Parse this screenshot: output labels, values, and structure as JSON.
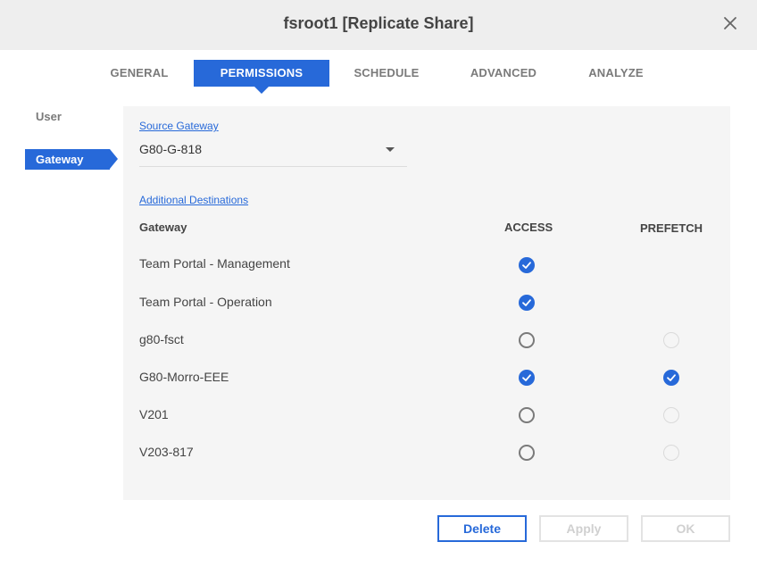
{
  "dialog": {
    "title": "fsroot1 [Replicate Share]"
  },
  "tabs": [
    {
      "label": "GENERAL",
      "active": false
    },
    {
      "label": "PERMISSIONS",
      "active": true
    },
    {
      "label": "SCHEDULE",
      "active": false
    },
    {
      "label": "ADVANCED",
      "active": false
    },
    {
      "label": "ANALYZE",
      "active": false
    }
  ],
  "sidebar": {
    "items": [
      {
        "label": "User",
        "active": false
      },
      {
        "label": "Gateway",
        "active": true
      }
    ]
  },
  "source_gateway": {
    "label": "Source Gateway",
    "value": "G80-G-818"
  },
  "additional_destinations": {
    "label": "Additional Destinations",
    "columns": {
      "gateway": "Gateway",
      "access": "ACCESS",
      "prefetch": "PREFETCH"
    },
    "rows": [
      {
        "name": "Team Portal - Management",
        "access": "checked",
        "prefetch": "none"
      },
      {
        "name": "Team Portal - Operation",
        "access": "checked",
        "prefetch": "none"
      },
      {
        "name": "g80-fsct",
        "access": "unchecked",
        "prefetch": "disabled"
      },
      {
        "name": "G80-Morro-EEE",
        "access": "checked",
        "prefetch": "checked"
      },
      {
        "name": "V201",
        "access": "unchecked",
        "prefetch": "disabled"
      },
      {
        "name": "V203-817",
        "access": "unchecked",
        "prefetch": "disabled"
      }
    ]
  },
  "buttons": {
    "delete": "Delete",
    "apply": "Apply",
    "ok": "OK"
  },
  "colors": {
    "accent": "#2769d9",
    "titlebar": "#eeeeee",
    "panel": "#f5f5f5"
  },
  "icons": {
    "close": "close-icon",
    "dropdown": "chevron-down-icon",
    "check": "check-icon"
  }
}
